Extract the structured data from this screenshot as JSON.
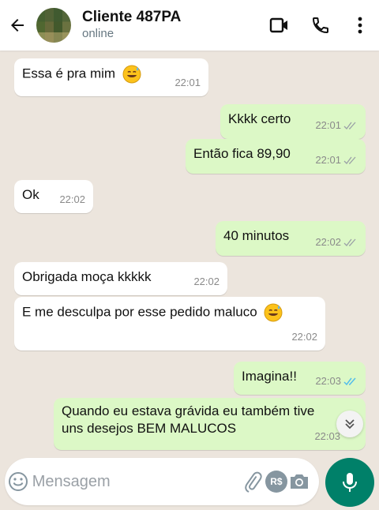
{
  "header": {
    "contact_name": "Cliente 487PA",
    "status": "online"
  },
  "messages": [
    {
      "direction": "in",
      "text": "Essa é pra mim",
      "emoji": "sweat-smile",
      "time": "22:01"
    },
    {
      "direction": "out",
      "text": "Kkkk certo",
      "time": "22:01",
      "ticks": "read-grey"
    },
    {
      "direction": "out",
      "text": "Então fica 89,90",
      "time": "22:01",
      "ticks": "read-grey"
    },
    {
      "direction": "in",
      "text": "Ok",
      "time": "22:02"
    },
    {
      "direction": "out",
      "text": "40 minutos",
      "time": "22:02",
      "ticks": "read-grey"
    },
    {
      "direction": "in",
      "text": "Obrigada moça kkkkk",
      "time": "22:02"
    },
    {
      "direction": "in",
      "text": "E me desculpa por esse pedido maluco",
      "emoji": "sweat-smile",
      "time": "22:02"
    },
    {
      "direction": "out",
      "text": "Imagina!!",
      "time": "22:03",
      "ticks": "read-blue"
    },
    {
      "direction": "out",
      "text_line1": "Quando eu estava grávida eu também tive",
      "text_line2": "uns desejos BEM MALUCOS",
      "time": "22:03"
    }
  ],
  "composer": {
    "placeholder": "Mensagem",
    "payment_label": "R$"
  },
  "colors": {
    "chat_background": "#ece5dd",
    "incoming_bubble": "#ffffff",
    "outgoing_bubble": "#dcf8c6",
    "accent": "#008069",
    "read_blue": "#53bdeb"
  },
  "icons": [
    "back-arrow-icon",
    "video-call-icon",
    "phone-icon",
    "more-options-icon",
    "emoji-icon",
    "attach-icon",
    "payment-icon",
    "camera-icon",
    "mic-icon",
    "scroll-down-icon"
  ]
}
